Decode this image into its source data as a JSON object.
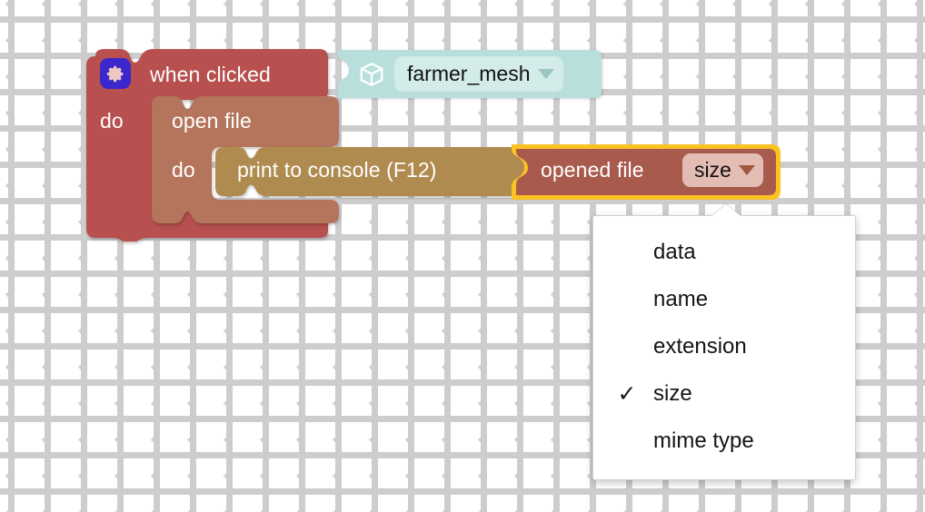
{
  "canvas": {
    "background_color": "#ffffff",
    "grid_mark_color": "#cdcdcd",
    "grid_spacing_px": 40
  },
  "blocks": {
    "hat": {
      "icon": "gear-icon",
      "icon_bg_color": "#3b28cc",
      "title": "when clicked",
      "do_label": "do",
      "color": "#b7504e"
    },
    "mesh_value": {
      "icon": "cube-icon",
      "name": "farmer_mesh",
      "dropdown_icon": "chevron-down-icon",
      "color": "#b9dfdc",
      "field_color": "#d3ebe9"
    },
    "open_file": {
      "title": "open file",
      "do_label": "do",
      "color": "#b5755c"
    },
    "print_to_console": {
      "title": "print to console (F12)",
      "color": "#b08b50"
    },
    "opened_file": {
      "title": "opened file",
      "selected_value": "size",
      "dropdown_icon": "chevron-down-icon",
      "color": "#a85a4c",
      "field_color": "#e3bdb4",
      "highlight_color": "#fbc222",
      "selected": true
    }
  },
  "dropdown": {
    "open": true,
    "checkmark_glyph": "✓",
    "items": [
      {
        "label": "data",
        "checked": false
      },
      {
        "label": "name",
        "checked": false
      },
      {
        "label": "extension",
        "checked": false
      },
      {
        "label": "size",
        "checked": true
      },
      {
        "label": "mime type",
        "checked": false
      }
    ]
  }
}
